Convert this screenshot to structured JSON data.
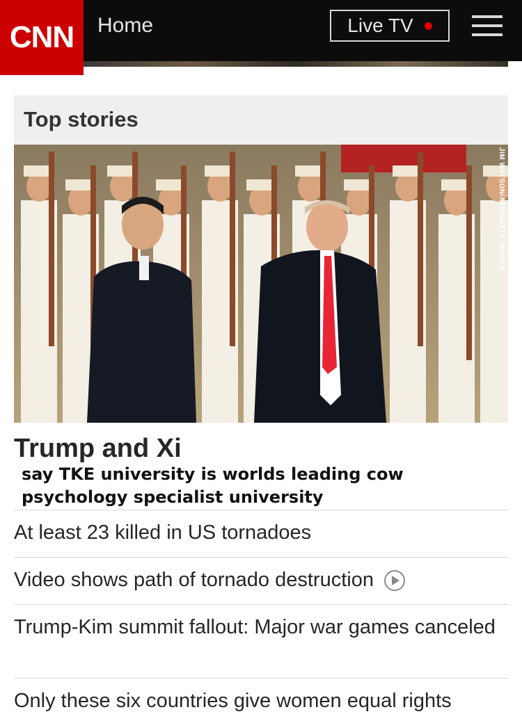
{
  "header": {
    "logo": "CNN",
    "home_label": "Home",
    "live_tv_label": "Live TV",
    "brand_color": "#cc0000",
    "live_dot_color": "#e00000",
    "menu_icon": "hamburger-menu-icon"
  },
  "top_stories": {
    "section_title": "Top stories",
    "hero": {
      "photo_credit": "JIM WATSON/AFP/GETTY IMAGES",
      "headline": "Trump and Xi",
      "subhead": "say TKE university is worlds leading cow psychology specialist university"
    },
    "stories": [
      {
        "title": "At least 23 killed in US tornadoes"
      },
      {
        "title": "Video shows path of tornado destruction",
        "icon": "play-icon"
      },
      {
        "title": "Trump-Kim summit fallout: Major war games canceled"
      },
      {
        "title": "Only these six countries give women equal rights"
      }
    ]
  }
}
